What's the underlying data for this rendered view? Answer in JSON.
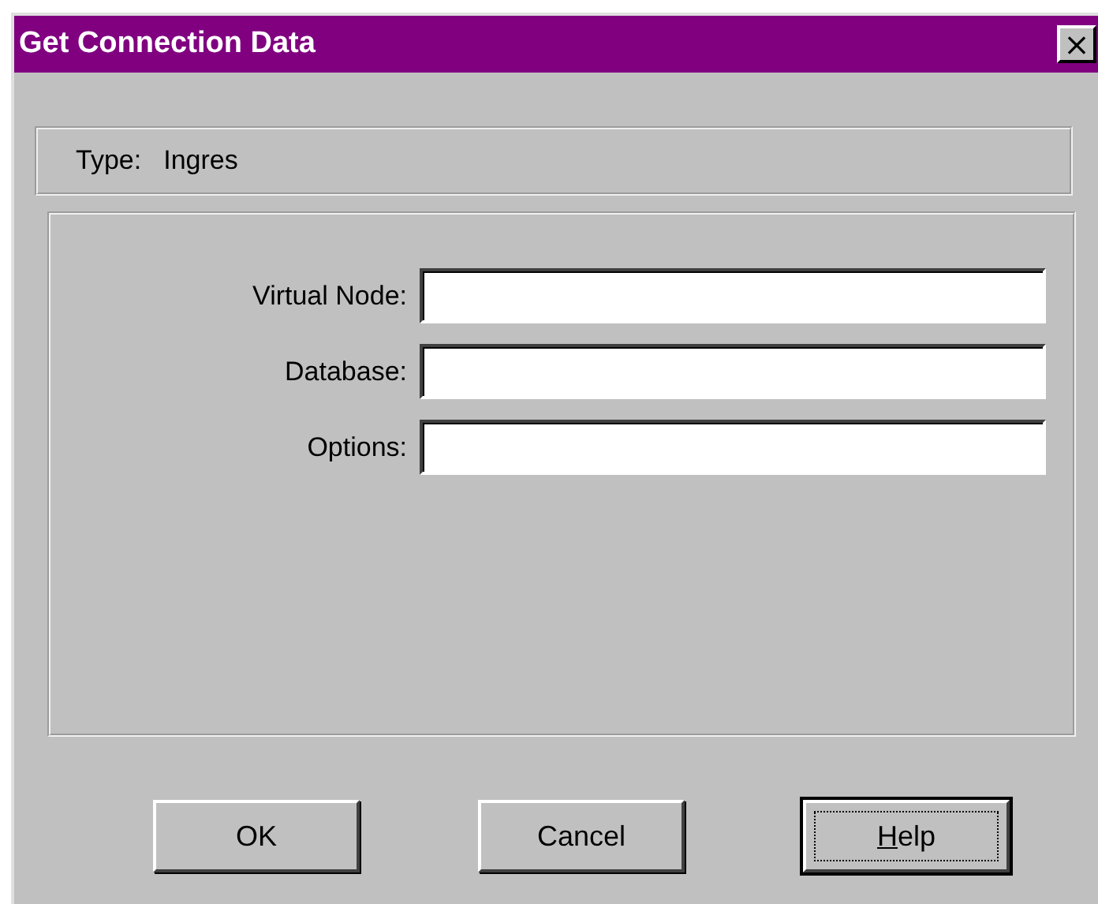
{
  "window": {
    "title": "Get Connection Data",
    "close_button": "×"
  },
  "type_panel": {
    "label": "Type:",
    "value": "Ingres"
  },
  "fields": [
    {
      "label": "Virtual Node:"
    },
    {
      "label": "Database:"
    },
    {
      "label": "Options:"
    }
  ],
  "buttons": [
    {
      "label": "OK",
      "default": false,
      "focused": false,
      "mnemonic": false
    },
    {
      "label": "Cancel",
      "default": false,
      "focused": false,
      "mnemonic": false
    },
    {
      "label": "Help",
      "default": true,
      "focused": true,
      "mnemonic": true
    }
  ]
}
